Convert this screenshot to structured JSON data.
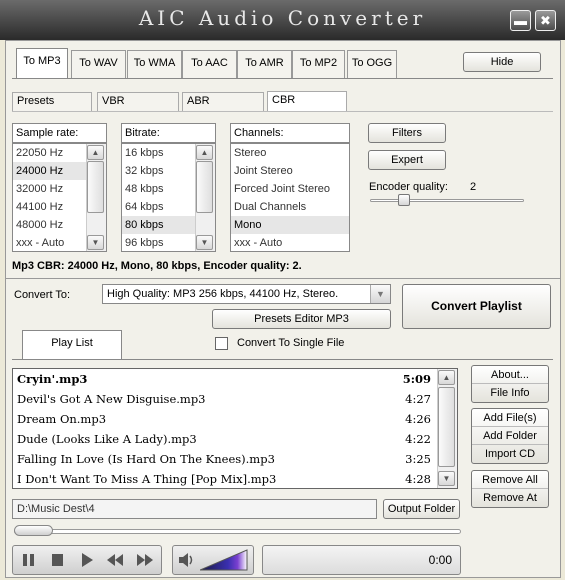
{
  "window": {
    "title": "AIC Audio Converter",
    "minimize_glyph": "▬",
    "close_glyph": "✖"
  },
  "format_tabs": [
    "To MP3",
    "To WAV",
    "To WMA",
    "To AAC",
    "To AMR",
    "To MP2",
    "To OGG"
  ],
  "hide_label": "Hide",
  "mode_tabs": [
    "Presets",
    "VBR",
    "ABR",
    "CBR"
  ],
  "sample_rate": {
    "header": "Sample rate:",
    "items": [
      "22050 Hz",
      "24000 Hz",
      "32000 Hz",
      "44100 Hz",
      "48000 Hz",
      "xxx - Auto"
    ],
    "selected": "24000 Hz"
  },
  "bitrate": {
    "header": "Bitrate:",
    "items": [
      "16 kbps",
      "32 kbps",
      "48 kbps",
      "64 kbps",
      "80 kbps",
      "96 kbps"
    ],
    "selected": "80 kbps"
  },
  "channels": {
    "header": "Channels:",
    "items": [
      "Stereo",
      "Joint Stereo",
      "Forced Joint Stereo",
      "Dual Channels",
      "Mono",
      "xxx - Auto"
    ],
    "selected": "Mono"
  },
  "filters_label": "Filters",
  "expert_label": "Expert",
  "encoder_quality": {
    "label": "Encoder quality:",
    "value": "2",
    "level_fraction": 0.2
  },
  "summary": "Mp3 CBR: 24000 Hz, Mono, 80 kbps, Encoder quality: 2.",
  "convert_to": {
    "label": "Convert To:",
    "value": "High Quality: MP3 256 kbps, 44100 Hz, Stereo."
  },
  "presets_editor_label": "Presets Editor MP3",
  "convert_playlist_label": "Convert Playlist",
  "playlist_tab": "Play List",
  "single_file_label": "Convert To Single File",
  "playlist": [
    {
      "name": "Cryin'.mp3",
      "time": "5:09",
      "bold": true
    },
    {
      "name": "Devil's Got A New Disguise.mp3",
      "time": "4:27"
    },
    {
      "name": "Dream On.mp3",
      "time": "4:26"
    },
    {
      "name": "Dude (Looks Like A Lady).mp3",
      "time": "4:22"
    },
    {
      "name": "Falling In Love (Is Hard On The Knees).mp3",
      "time": "3:25"
    },
    {
      "name": "I Don't Want To Miss A Thing [Pop Mix].mp3",
      "time": "4:28"
    }
  ],
  "side_buttons": {
    "about": "About...",
    "file_info": "File Info",
    "add_files": "Add File(s)",
    "add_folder": "Add Folder",
    "import_cd": "Import CD",
    "remove_all": "Remove All",
    "remove_at": "Remove At"
  },
  "output_path": "D:\\Music Dest\\4",
  "output_folder_label": "Output Folder",
  "time_display": "0:00"
}
